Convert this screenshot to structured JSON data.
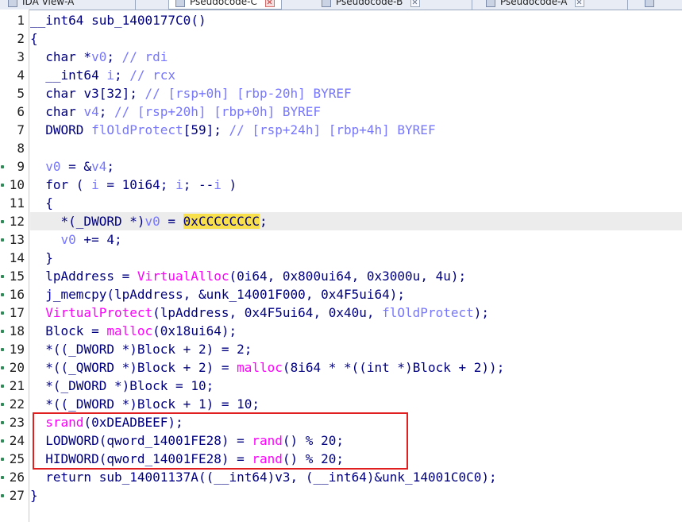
{
  "tabs": [
    {
      "label": "IDA View-A",
      "active": false
    },
    {
      "label": "Pseudocode-C",
      "active": true
    },
    {
      "label": "Pseudocode-B",
      "active": false
    },
    {
      "label": "Pseudocode-A",
      "active": false
    }
  ],
  "line_numbers": [
    "1",
    "2",
    "3",
    "4",
    "5",
    "6",
    "7",
    "8",
    "9",
    "10",
    "11",
    "12",
    "13",
    "14",
    "15",
    "16",
    "17",
    "18",
    "19",
    "20",
    "21",
    "22",
    "23",
    "24",
    "25",
    "26",
    "27"
  ],
  "code": [
    "__int64 sub_1400177C0()",
    "{",
    "  char *v0; // rdi",
    "  __int64 i; // rcx",
    "  char v3[32]; // [rsp+0h] [rbp-20h] BYREF",
    "  char v4; // [rsp+20h] [rbp+0h] BYREF",
    "  DWORD flOldProtect[59]; // [rsp+24h] [rbp+4h] BYREF",
    "",
    "  v0 = &v4;",
    "  for ( i = 10i64; i; --i )",
    "  {",
    "    *(_DWORD *)v0 = 0xCCCCCCCC;",
    "    v0 += 4;",
    "  }",
    "  lpAddress = VirtualAlloc(0i64, 0x800ui64, 0x3000u, 4u);",
    "  j_memcpy(lpAddress, &unk_14001F000, 0x4F5ui64);",
    "  VirtualProtect(lpAddress, 0x4F5ui64, 0x40u, flOldProtect);",
    "  Block = malloc(0x18ui64);",
    "  *((_DWORD *)Block + 2) = 2;",
    "  *((_QWORD *)Block + 2) = malloc(8i64 * *((int *)Block + 2));",
    "  *(_DWORD *)Block = 10;",
    "  *((_DWORD *)Block + 1) = 10;",
    "  srand(0xDEADBEEF);",
    "  LODWORD(qword_14001FE28) = rand() % 20;",
    "  HIDWORD(qword_14001FE28) = rand() % 20;",
    "  return sub_14001137A((__int64)v3, (__int64)&unk_14001C0C0);",
    "}"
  ],
  "highlighted_line": 12,
  "colors": {
    "keyword": "#000080",
    "comment": "#808080",
    "function": "#ff00ff",
    "highlight_bg": "#ececec",
    "hex_highlight": "#f7e04b",
    "annotation_box": "#e02020"
  }
}
